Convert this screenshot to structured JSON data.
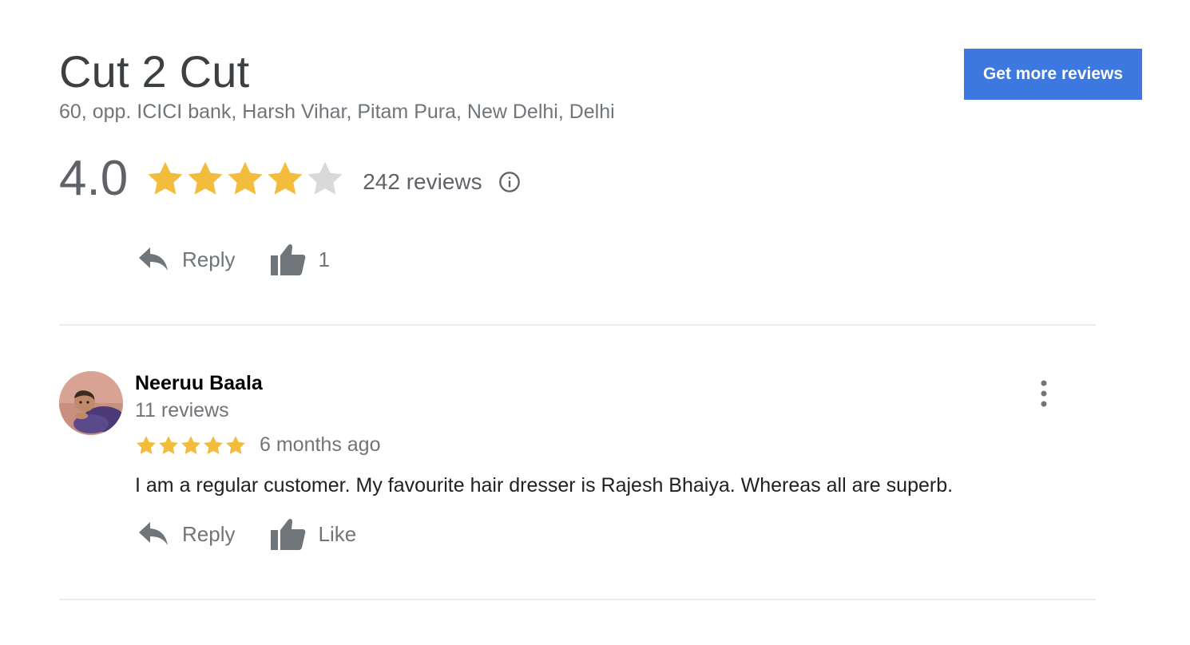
{
  "business": {
    "name": "Cut 2 Cut",
    "address": "60, opp. ICICI bank, Harsh Vihar, Pitam Pura, New Delhi, Delhi"
  },
  "header": {
    "get_more_reviews_label": "Get more reviews"
  },
  "rating": {
    "score": "4.0",
    "stars_filled": 4,
    "stars_total": 5,
    "review_count": "242 reviews",
    "info_icon": "info-icon"
  },
  "first_actions": {
    "reply_label": "Reply",
    "like_label": "1"
  },
  "review": {
    "author": "Neeruu Baala",
    "author_reviews": "11 reviews",
    "stars": 5,
    "time": "6 months ago",
    "text": "I am a regular customer. My favourite hair dresser is Rajesh Bhaiya. Whereas all are superb.",
    "reply_label": "Reply",
    "like_label": "Like",
    "more_icon": "more-vertical-icon"
  },
  "colors": {
    "star_filled": "#f2bd3d",
    "star_empty": "#d9d9d9",
    "button_bg": "#3c78e0",
    "icon_gray": "#70757a"
  }
}
